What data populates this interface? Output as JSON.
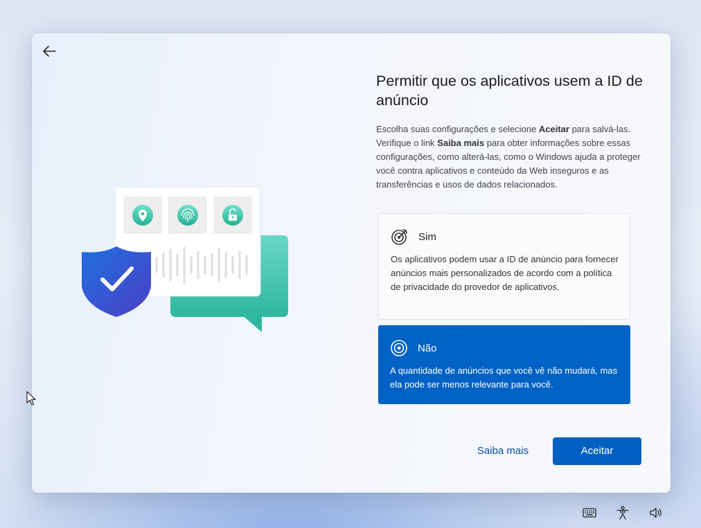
{
  "page": {
    "title": "Permitir que os aplicativos usem a ID de anúncio",
    "description_parts": [
      "Escolha suas configurações e selecione ",
      "Aceitar",
      " para salvá-las. Verifique o link ",
      "Saiba mais",
      " para obter informações sobre essas configurações, como alterá-las, como o Windows ajuda a proteger você contra aplicativos e conteúdo da Web inseguros e as transferências e usos de dados relacionados."
    ]
  },
  "options": {
    "yes": {
      "title": "Sim",
      "text": "Os aplicativos podem usar a ID de anúncio para fornecer anúncios mais personalizados de acordo com a política de privacidade do provedor de aplicativos.",
      "icon": "target-arrow-icon",
      "selected": false
    },
    "no": {
      "title": "Não",
      "text": "A quantidade de anúncios que você vê não mudará, mas ela pode ser menos relevante para você.",
      "icon": "target-icon",
      "selected": true
    }
  },
  "actions": {
    "learn_more": "Saiba mais",
    "accept": "Aceitar"
  },
  "tray": [
    "keyboard-icon",
    "accessibility-icon",
    "volume-icon"
  ],
  "colors": {
    "accent": "#0062c4",
    "link": "#0a4f9e",
    "teal": "#3fc5ae",
    "shield": "#2f5fd0"
  }
}
